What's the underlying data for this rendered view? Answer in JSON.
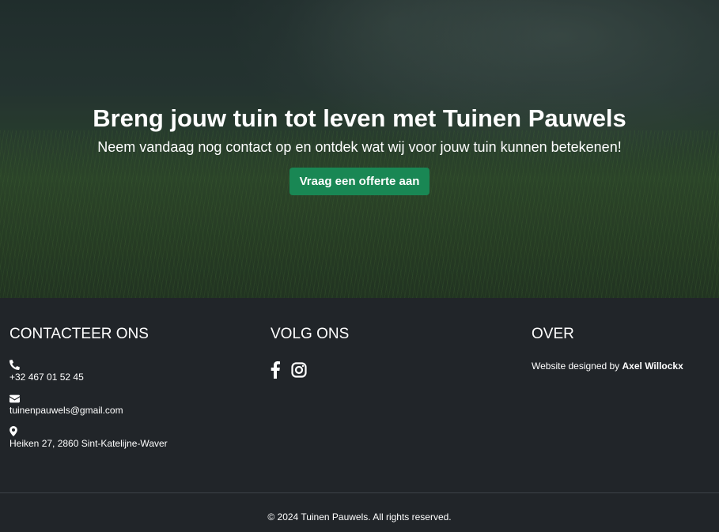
{
  "hero": {
    "title": "Breng jouw tuin tot leven met Tuinen Pauwels",
    "subtitle": "Neem vandaag nog contact op en ontdek wat wij voor jouw tuin kunnen betekenen!",
    "cta_label": "Vraag een offerte aan",
    "cta_color": "#198754"
  },
  "footer": {
    "contact": {
      "title": "CONTACTEER ONS",
      "phone_icon": "phone-icon",
      "phone": "+32 467 01 52 45",
      "email_icon": "envelope-icon",
      "email": "tuinenpauwels@gmail.com",
      "address_icon": "map-marker-icon",
      "address": "Heiken 27, 2860 Sint-Katelijne-Waver"
    },
    "follow": {
      "title": "VOLG ONS",
      "icons": [
        "facebook-icon",
        "instagram-icon"
      ]
    },
    "about": {
      "title": "OVER",
      "designed_by_prefix": "Website designed by ",
      "designer": "Axel Willockx"
    },
    "copyright": "© 2024 Tuinen Pauwels. All rights reserved.",
    "background": "#212529"
  }
}
